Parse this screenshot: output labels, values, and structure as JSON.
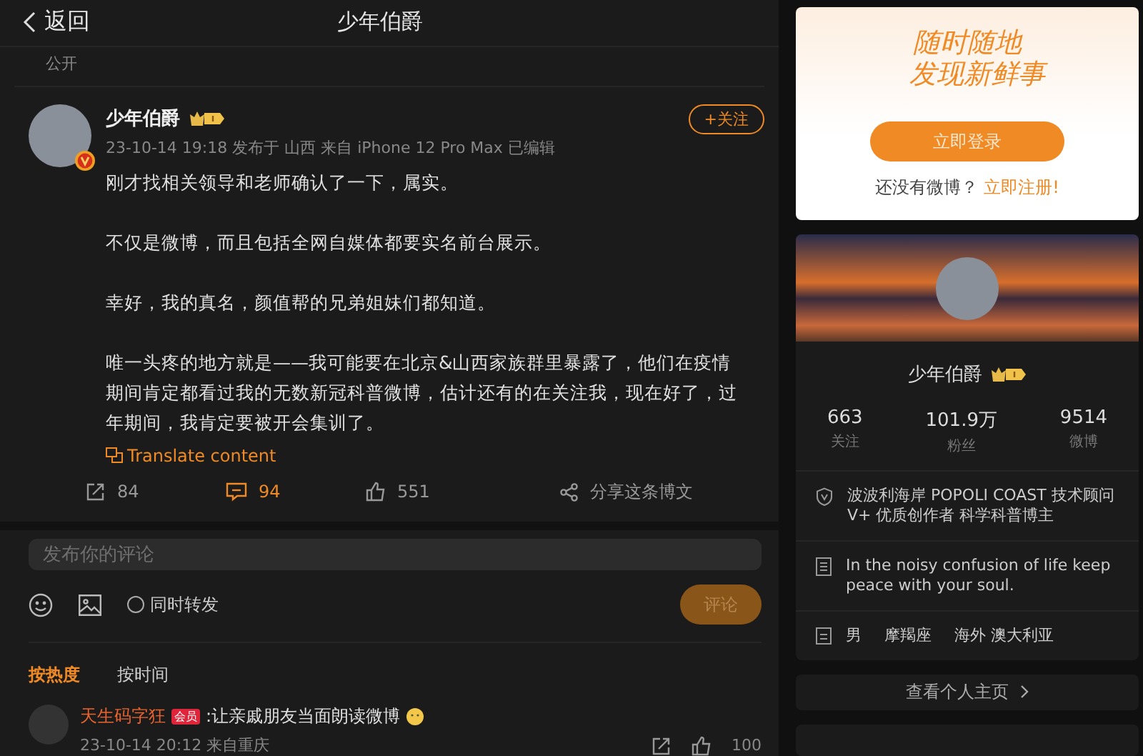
{
  "header": {
    "back": "返回",
    "title": "少年伯爵"
  },
  "visibility": "公开",
  "post": {
    "author": "少年伯爵",
    "follow": "+关注",
    "meta": "23-10-14 19:18 发布于 山西 来自 iPhone 12 Pro Max 已编辑",
    "paragraphs": [
      "刚才找相关领导和老师确认了一下，属实。",
      "不仅是微博，而且包括全网自媒体都要实名前台展示。",
      "幸好，我的真名，颜值帮的兄弟姐妹们都知道。",
      "唯一头疼的地方就是——我可能要在北京&山西家族群里暴露了，他们在疫情期间肯定都看过我的无数新冠科普微博，估计还有的在关注我，现在好了，过年期间，我肯定要被开会集训了。"
    ],
    "translate": "Translate content",
    "actions": [
      {
        "kind": "repost",
        "label": "84",
        "selected": false
      },
      {
        "kind": "comment",
        "label": "94",
        "selected": true
      },
      {
        "kind": "like",
        "label": "551",
        "selected": false
      },
      {
        "kind": "share",
        "label": "分享这条博文",
        "selected": false
      }
    ]
  },
  "compose": {
    "placeholder": "发布你的评论",
    "repost_label": "同时转发",
    "repost_checked": false,
    "submit": "评论",
    "submit_disabled": true
  },
  "sort_tabs": [
    {
      "label": "按热度",
      "selected": true
    },
    {
      "label": "按时间",
      "selected": false
    }
  ],
  "comment": {
    "user": "天生码字狂",
    "badge": "会员",
    "text": ":让亲戚朋友当面朗读微博",
    "meta": "23-10-14 20:12 来自重庆",
    "likes": "100"
  },
  "login_card": {
    "slogan_1": "随时随地",
    "slogan_2": "发现新鲜事",
    "login": "立即登录",
    "prompt": "还没有微博？",
    "register": "立即注册!"
  },
  "profile": {
    "name": "少年伯爵",
    "stats": [
      {
        "value": "663",
        "label": "关注"
      },
      {
        "value": "101.9万",
        "label": "粉丝"
      },
      {
        "value": "9514",
        "label": "微博"
      }
    ],
    "info": [
      {
        "kind": "verified",
        "text": "波波利海岸 POPOLI COAST 技术顾问 V+ 优质创作者 科学科普博主"
      },
      {
        "kind": "bio",
        "text": "In the noisy confusion of life keep peace with your soul."
      },
      {
        "kind": "details",
        "items": [
          "男",
          "摩羯座",
          "海外 澳大利亚"
        ]
      }
    ],
    "homepage": "查看个人主页"
  }
}
